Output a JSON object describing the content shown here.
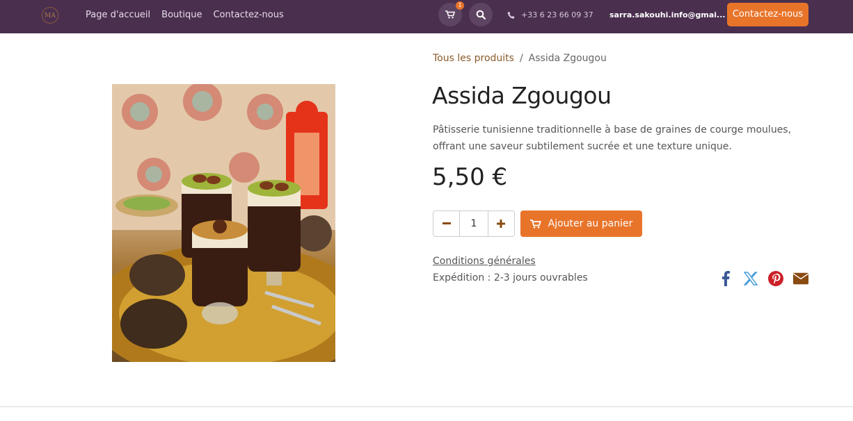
{
  "header": {
    "logo_text": "MA",
    "nav": [
      "Page d'accueil",
      "Boutique",
      "Contactez-nous"
    ],
    "cart_count": "1",
    "phone": "+33 6 23 66 09 37",
    "user_email": "sarra.sakouhi.info@gmai...",
    "contact_button": "Contactez-nous",
    "colors": {
      "bar": "#4a2f4f",
      "accent": "#e8742a"
    }
  },
  "breadcrumb": {
    "parent": "Tous les produits",
    "separator": "/",
    "current": "Assida Zgougou"
  },
  "product": {
    "title": "Assida Zgougou",
    "description": "Pâtisserie tunisienne traditionnelle à base de graines de courge moulues, offrant une saveur subtilement sucrée et une texture unique.",
    "price": "5,50 €",
    "quantity": "1",
    "add_to_cart": "Ajouter au panier",
    "terms": "Conditions générales",
    "shipping": "Expédition : 2-3 jours ouvrables"
  },
  "icons": {
    "cart": "cart-icon",
    "search": "search-icon",
    "phone": "phone-icon",
    "minus": "minus-icon",
    "plus": "plus-icon",
    "facebook": "facebook-icon",
    "x": "x-icon",
    "pinterest": "pinterest-icon",
    "email": "envelope-icon"
  }
}
